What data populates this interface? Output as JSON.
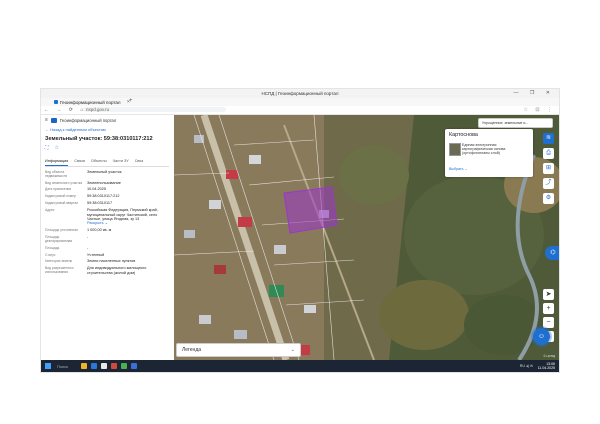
{
  "window": {
    "title": "НСПД | Геоинформационный портал",
    "controls": "— ❐ ✕"
  },
  "browser": {
    "tab_label": "Геоинформационный портал",
    "tab_close": "✕",
    "new_tab": "+",
    "nav_icons": "← → ⟳ ⌂",
    "url": "nspd.gov.ru",
    "tool_icons": "☆ ⊡ ⋮"
  },
  "panel": {
    "brand": "Геоинформационный портал",
    "menu_icon": "≡",
    "back_link": "← Назад к найденным объектам",
    "object_title": "Земельный участок: 59:38:0310117:212",
    "action_icons": [
      "⛶",
      "☆"
    ],
    "tabs": [
      "Информация",
      "Связи",
      "Объекты",
      "Части ЗУ",
      "Связ"
    ],
    "active_tab": 0,
    "attributes": [
      {
        "label": "Вид объекта недвижимости",
        "value": "Земельный участок"
      },
      {
        "label": "Вид земельного участка",
        "value": "Землепользование"
      },
      {
        "label": "Дата присвоения",
        "value": "10.04.2025"
      },
      {
        "label": "Кадастровый номер",
        "value": "59:38:0310117:212"
      },
      {
        "label": "Кадастровый квартал",
        "value": "59:38:0310117"
      },
      {
        "label": "Адрес",
        "value": "Российская Федерация, Пермский край, муниципальный округ Частинский, село Частые, улица Ягодная, зу 13",
        "more": "Раскрыть ⌄"
      },
      {
        "label": "Площадь уточненная",
        "value": "1 000,00 кв. м"
      },
      {
        "label": "Площадь декларированная",
        "value": "-"
      },
      {
        "label": "Площадь",
        "value": "-"
      },
      {
        "label": "Статус",
        "value": "Учтенный"
      },
      {
        "label": "Категория земель",
        "value": "Земли населенных пунктов"
      },
      {
        "label": "Вид разрешенного использования",
        "value": "Для индивидуального жилищного строительства (жилой дом)"
      }
    ]
  },
  "map": {
    "layer_select": "Упрощенное: земельные и...",
    "cartography": {
      "heading": "Картоснова",
      "description": "Единая электронная картографическая основа (ортофотопланы слой)",
      "select_link": "Выбрать ⌄"
    },
    "right_tools": [
      "layers-icon",
      "print-icon",
      "measure-icon",
      "share-icon",
      "settings-icon"
    ],
    "right_tool_glyphs": [
      "≋",
      "⎙",
      "⊞",
      "⤴",
      "⚙"
    ],
    "side_bubble": "⌬",
    "zoom_tools": [
      "➤",
      "+",
      "−",
      "⌂"
    ],
    "chat_glyph": "☺",
    "legend_label": "Легенда",
    "legend_chevron": "⌄",
    "attribution": "© НСПД",
    "colors": {
      "highlight_parcel": "#9b37c9",
      "accent": "#1f6fd1"
    }
  },
  "taskbar": {
    "search_placeholder": "Поиск",
    "tray_text": "RU ◂) ✉",
    "time": "13:06",
    "date": "11.04.2025"
  }
}
